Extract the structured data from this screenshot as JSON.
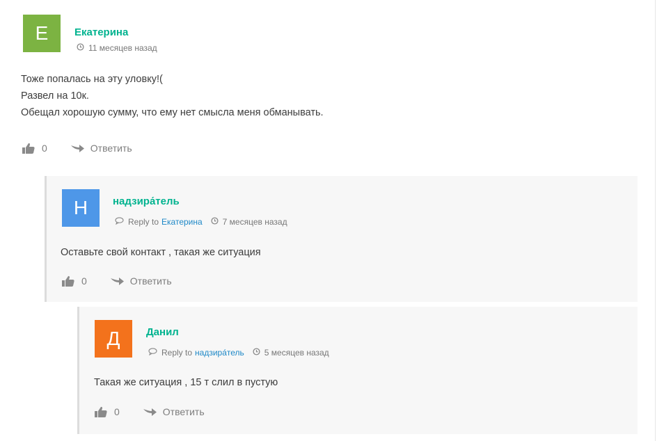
{
  "comments": [
    {
      "initial": "Е",
      "avatar_color": "#7cb342",
      "author": "Екатерина",
      "time": "11 месяцев назад",
      "lines": [
        "Тоже попалась на эту уловку!(",
        "Развел на 10к.",
        "Обещал хорошую сумму, что ему нет смысла меня обманывать."
      ],
      "likes": "0",
      "reply_label": "Ответить"
    },
    {
      "initial": "Н",
      "avatar_color": "#4e97e8",
      "author": "надзира́тель",
      "reply_to_label": "Reply to",
      "reply_to_name": "Екатерина",
      "time": "7 месяцев назад",
      "lines": [
        "Оставьте свой контакт , такая же ситуация"
      ],
      "likes": "0",
      "reply_label": "Ответить"
    },
    {
      "initial": "Д",
      "avatar_color": "#f3721c",
      "author": "Данил",
      "reply_to_label": "Reply to",
      "reply_to_name": "надзира́тель",
      "time": "5 месяцев назад",
      "lines": [
        "Такая же ситуация , 15 т слил в пустую"
      ],
      "likes": "0",
      "reply_label": "Ответить"
    }
  ]
}
